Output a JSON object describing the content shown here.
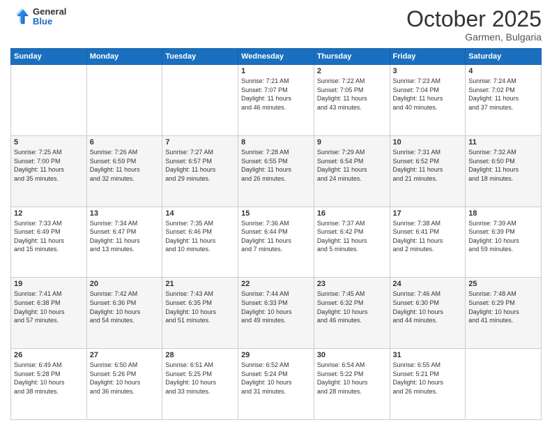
{
  "header": {
    "logo_line1": "General",
    "logo_line2": "Blue",
    "title": "October 2025",
    "subtitle": "Garmen, Bulgaria"
  },
  "weekdays": [
    "Sunday",
    "Monday",
    "Tuesday",
    "Wednesday",
    "Thursday",
    "Friday",
    "Saturday"
  ],
  "weeks": [
    [
      {
        "day": "",
        "info": ""
      },
      {
        "day": "",
        "info": ""
      },
      {
        "day": "",
        "info": ""
      },
      {
        "day": "1",
        "info": "Sunrise: 7:21 AM\nSunset: 7:07 PM\nDaylight: 11 hours\nand 46 minutes."
      },
      {
        "day": "2",
        "info": "Sunrise: 7:22 AM\nSunset: 7:05 PM\nDaylight: 11 hours\nand 43 minutes."
      },
      {
        "day": "3",
        "info": "Sunrise: 7:23 AM\nSunset: 7:04 PM\nDaylight: 11 hours\nand 40 minutes."
      },
      {
        "day": "4",
        "info": "Sunrise: 7:24 AM\nSunset: 7:02 PM\nDaylight: 11 hours\nand 37 minutes."
      }
    ],
    [
      {
        "day": "5",
        "info": "Sunrise: 7:25 AM\nSunset: 7:00 PM\nDaylight: 11 hours\nand 35 minutes."
      },
      {
        "day": "6",
        "info": "Sunrise: 7:26 AM\nSunset: 6:59 PM\nDaylight: 11 hours\nand 32 minutes."
      },
      {
        "day": "7",
        "info": "Sunrise: 7:27 AM\nSunset: 6:57 PM\nDaylight: 11 hours\nand 29 minutes."
      },
      {
        "day": "8",
        "info": "Sunrise: 7:28 AM\nSunset: 6:55 PM\nDaylight: 11 hours\nand 26 minutes."
      },
      {
        "day": "9",
        "info": "Sunrise: 7:29 AM\nSunset: 6:54 PM\nDaylight: 11 hours\nand 24 minutes."
      },
      {
        "day": "10",
        "info": "Sunrise: 7:31 AM\nSunset: 6:52 PM\nDaylight: 11 hours\nand 21 minutes."
      },
      {
        "day": "11",
        "info": "Sunrise: 7:32 AM\nSunset: 6:50 PM\nDaylight: 11 hours\nand 18 minutes."
      }
    ],
    [
      {
        "day": "12",
        "info": "Sunrise: 7:33 AM\nSunset: 6:49 PM\nDaylight: 11 hours\nand 15 minutes."
      },
      {
        "day": "13",
        "info": "Sunrise: 7:34 AM\nSunset: 6:47 PM\nDaylight: 11 hours\nand 13 minutes."
      },
      {
        "day": "14",
        "info": "Sunrise: 7:35 AM\nSunset: 6:46 PM\nDaylight: 11 hours\nand 10 minutes."
      },
      {
        "day": "15",
        "info": "Sunrise: 7:36 AM\nSunset: 6:44 PM\nDaylight: 11 hours\nand 7 minutes."
      },
      {
        "day": "16",
        "info": "Sunrise: 7:37 AM\nSunset: 6:42 PM\nDaylight: 11 hours\nand 5 minutes."
      },
      {
        "day": "17",
        "info": "Sunrise: 7:38 AM\nSunset: 6:41 PM\nDaylight: 11 hours\nand 2 minutes."
      },
      {
        "day": "18",
        "info": "Sunrise: 7:39 AM\nSunset: 6:39 PM\nDaylight: 10 hours\nand 59 minutes."
      }
    ],
    [
      {
        "day": "19",
        "info": "Sunrise: 7:41 AM\nSunset: 6:38 PM\nDaylight: 10 hours\nand 57 minutes."
      },
      {
        "day": "20",
        "info": "Sunrise: 7:42 AM\nSunset: 6:36 PM\nDaylight: 10 hours\nand 54 minutes."
      },
      {
        "day": "21",
        "info": "Sunrise: 7:43 AM\nSunset: 6:35 PM\nDaylight: 10 hours\nand 51 minutes."
      },
      {
        "day": "22",
        "info": "Sunrise: 7:44 AM\nSunset: 6:33 PM\nDaylight: 10 hours\nand 49 minutes."
      },
      {
        "day": "23",
        "info": "Sunrise: 7:45 AM\nSunset: 6:32 PM\nDaylight: 10 hours\nand 46 minutes."
      },
      {
        "day": "24",
        "info": "Sunrise: 7:46 AM\nSunset: 6:30 PM\nDaylight: 10 hours\nand 44 minutes."
      },
      {
        "day": "25",
        "info": "Sunrise: 7:48 AM\nSunset: 6:29 PM\nDaylight: 10 hours\nand 41 minutes."
      }
    ],
    [
      {
        "day": "26",
        "info": "Sunrise: 6:49 AM\nSunset: 5:28 PM\nDaylight: 10 hours\nand 38 minutes."
      },
      {
        "day": "27",
        "info": "Sunrise: 6:50 AM\nSunset: 5:26 PM\nDaylight: 10 hours\nand 36 minutes."
      },
      {
        "day": "28",
        "info": "Sunrise: 6:51 AM\nSunset: 5:25 PM\nDaylight: 10 hours\nand 33 minutes."
      },
      {
        "day": "29",
        "info": "Sunrise: 6:52 AM\nSunset: 5:24 PM\nDaylight: 10 hours\nand 31 minutes."
      },
      {
        "day": "30",
        "info": "Sunrise: 6:54 AM\nSunset: 5:22 PM\nDaylight: 10 hours\nand 28 minutes."
      },
      {
        "day": "31",
        "info": "Sunrise: 6:55 AM\nSunset: 5:21 PM\nDaylight: 10 hours\nand 26 minutes."
      },
      {
        "day": "",
        "info": ""
      }
    ]
  ]
}
